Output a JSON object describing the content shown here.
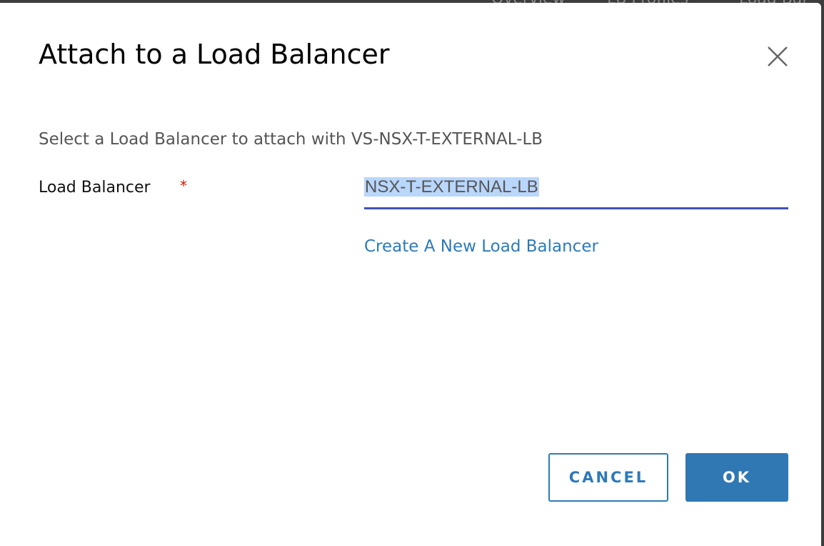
{
  "background_tabs": [
    "Overview",
    "LB Profiles",
    "Load Bal"
  ],
  "dialog": {
    "title": "Attach to a Load Balancer",
    "subtitle": "Select a Load Balancer to attach with VS-NSX-T-EXTERNAL-LB",
    "field_label": "Load Balancer",
    "required_marker": "*",
    "field_value": "NSX-T-EXTERNAL-LB",
    "create_link": "Create A New Load Balancer",
    "cancel_label": "CANCEL",
    "ok_label": "OK"
  }
}
